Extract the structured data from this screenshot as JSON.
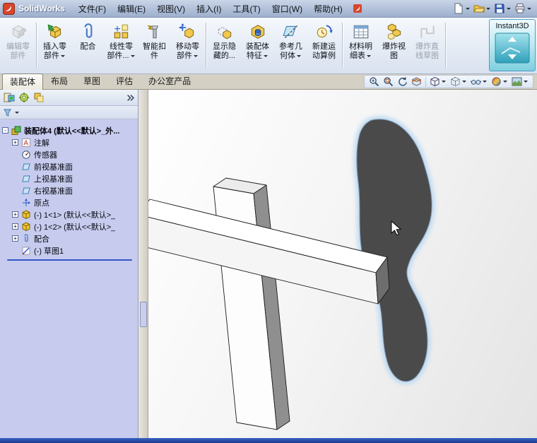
{
  "window": {
    "app_title": "SolidWorks"
  },
  "menubar": {
    "items": [
      "文件(F)",
      "编辑(E)",
      "视图(V)",
      "插入(I)",
      "工具(T)",
      "窗口(W)",
      "帮助(H)"
    ]
  },
  "quickbar": {
    "buttons": [
      "new-document",
      "open-document",
      "save-document",
      "print-document"
    ]
  },
  "command_manager": {
    "buttons": [
      {
        "line1": "编辑零",
        "line2": "部件",
        "disabled": true,
        "dropdown": false,
        "icon": "edit-component-icon"
      },
      {
        "line1": "插入零",
        "line2": "部件",
        "disabled": false,
        "dropdown": true,
        "icon": "insert-component-icon"
      },
      {
        "line1": "配合",
        "line2": "",
        "disabled": false,
        "dropdown": false,
        "icon": "mate-icon"
      },
      {
        "line1": "线性零",
        "line2": "部件...",
        "disabled": false,
        "dropdown": true,
        "icon": "linear-pattern-icon"
      },
      {
        "line1": "智能扣",
        "line2": "件",
        "disabled": false,
        "dropdown": false,
        "icon": "smart-fasteners-icon"
      },
      {
        "line1": "移动零",
        "line2": "部件",
        "disabled": false,
        "dropdown": true,
        "icon": "move-component-icon"
      },
      {
        "line1": "显示隐",
        "line2": "藏的...",
        "disabled": false,
        "dropdown": false,
        "icon": "show-hidden-icon"
      },
      {
        "line1": "装配体",
        "line2": "特征",
        "disabled": false,
        "dropdown": true,
        "icon": "assembly-features-icon"
      },
      {
        "line1": "参考几",
        "line2": "何体",
        "disabled": false,
        "dropdown": true,
        "icon": "reference-geometry-icon"
      },
      {
        "line1": "新建运",
        "line2": "动算例",
        "disabled": false,
        "dropdown": false,
        "icon": "motion-study-icon"
      },
      {
        "line1": "材料明",
        "line2": "细表",
        "disabled": false,
        "dropdown": true,
        "icon": "bom-icon"
      },
      {
        "line1": "爆炸视",
        "line2": "图",
        "disabled": false,
        "dropdown": false,
        "icon": "exploded-view-icon"
      },
      {
        "line1": "爆炸直",
        "line2": "线草图",
        "disabled": true,
        "dropdown": false,
        "icon": "explode-line-sketch-icon"
      }
    ],
    "instant3d_label": "Instant3D",
    "instant3d_active": true
  },
  "tabs": {
    "items": [
      "装配体",
      "布局",
      "草图",
      "评估",
      "办公室产品"
    ],
    "active_index": 0
  },
  "view_toolbar": {
    "icons": [
      "zoom-fit",
      "zoom-area",
      "previous-view",
      "section-view",
      "view-orientation",
      "display-style",
      "hide-show-items",
      "edit-appearance",
      "apply-scene"
    ]
  },
  "feature_tree": {
    "panel_icons": [
      "featuremanager-tree",
      "propertymanager",
      "configurationmanager"
    ],
    "root": {
      "label": "装配体4 (默认<<默认>_外...",
      "expander": "-"
    },
    "items": [
      {
        "label": "注解",
        "expander": "+",
        "icon": "annotations-icon"
      },
      {
        "label": "传感器",
        "expander": "",
        "icon": "sensors-icon"
      },
      {
        "label": "前视基准面",
        "expander": "",
        "icon": "plane-icon"
      },
      {
        "label": "上视基准面",
        "expander": "",
        "icon": "plane-icon"
      },
      {
        "label": "右视基准面",
        "expander": "",
        "icon": "plane-icon"
      },
      {
        "label": "原点",
        "expander": "",
        "icon": "origin-icon"
      },
      {
        "label": "(-) 1<1> (默认<<默认>_",
        "expander": "+",
        "icon": "part-icon"
      },
      {
        "label": "(-) 1<2> (默认<<默认>_",
        "expander": "+",
        "icon": "part-icon"
      },
      {
        "label": "配合",
        "expander": "+",
        "icon": "mates-icon"
      },
      {
        "label": "(-) 草图1",
        "expander": "",
        "icon": "sketch-icon"
      }
    ]
  },
  "viewport": {
    "content": "3D assembly of two crossed rectangular bars with a dark highlighted free-form part",
    "colors": {
      "highlight_part": "#4a4a4a",
      "selection_glow": "#c2dcf2",
      "bar_face": "#ffffff",
      "bar_side": "#909090"
    }
  },
  "colors": {
    "tree_background": "#c7ccee",
    "titlebar": "#9db0cd",
    "instant3d_teal": "#7fd0df",
    "statusbar": "#1c3a8c"
  }
}
